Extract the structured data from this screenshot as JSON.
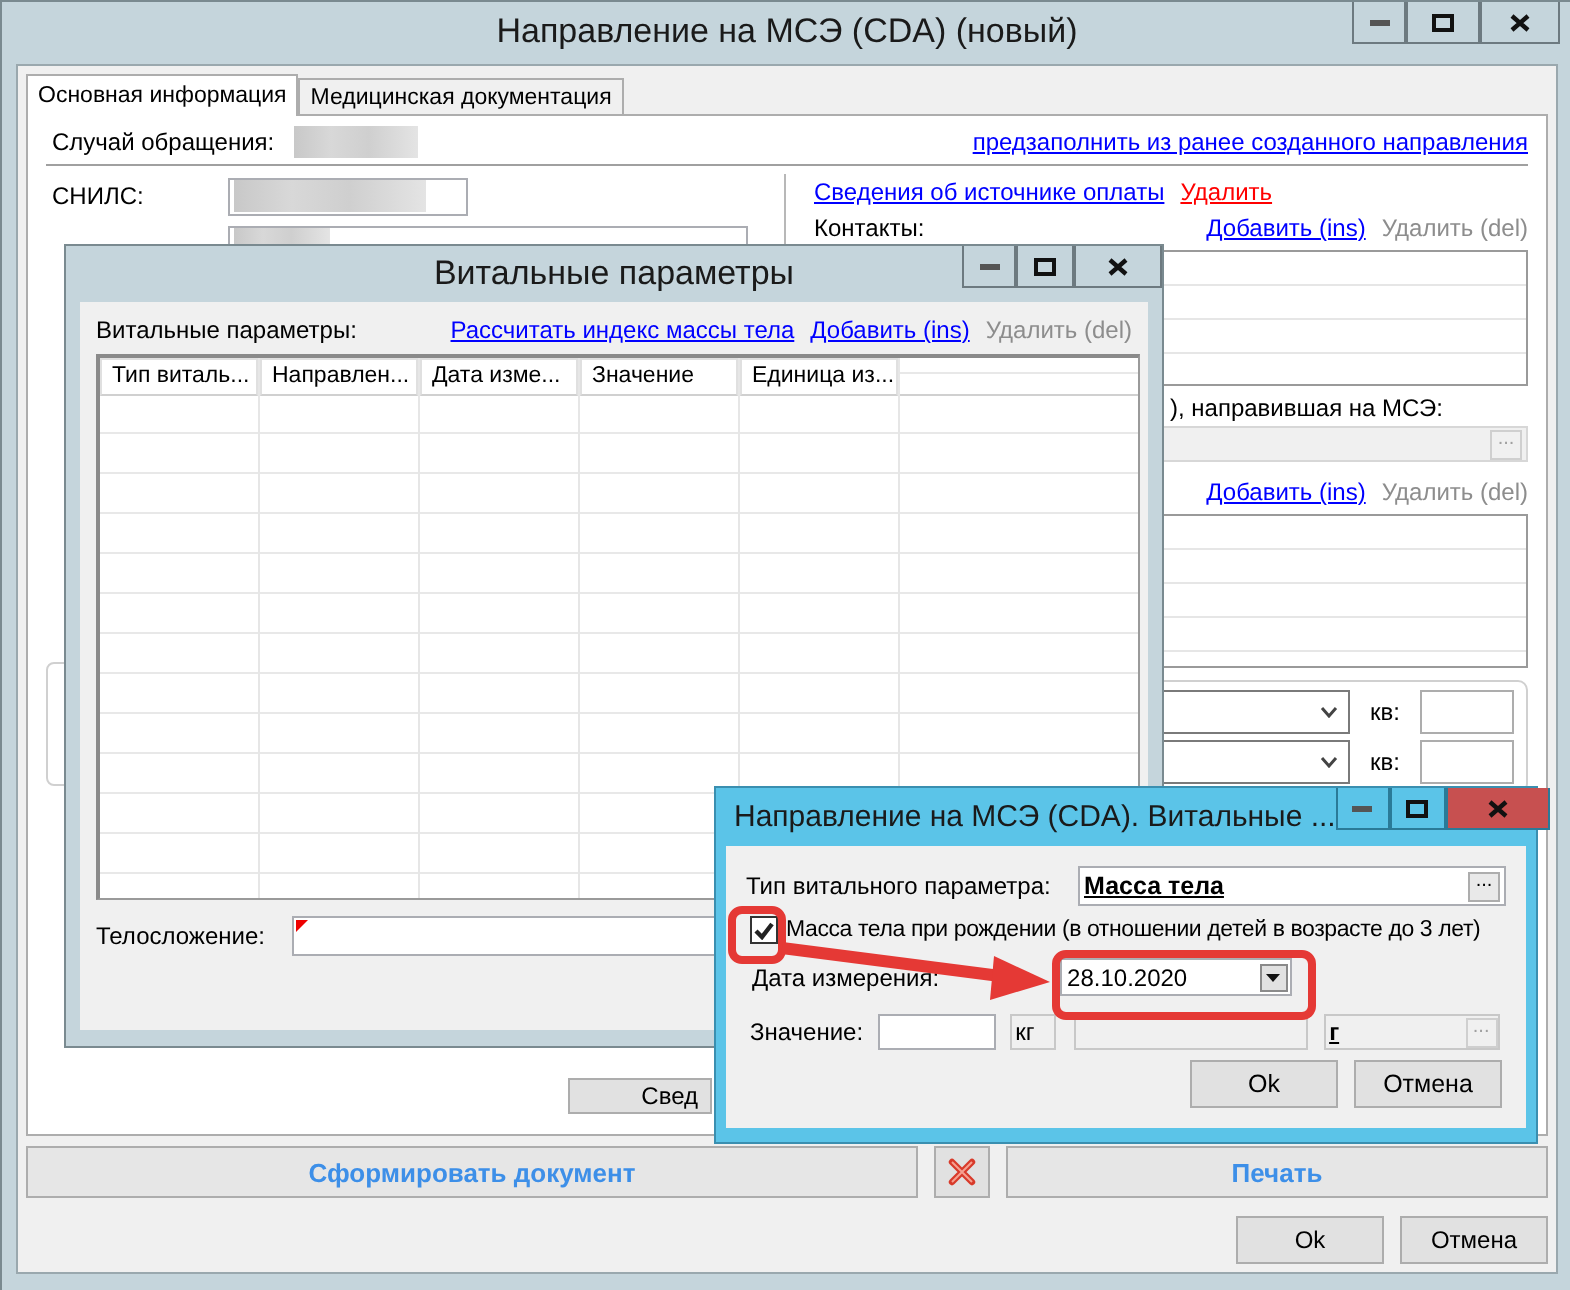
{
  "main_window": {
    "title": "Направление на МСЭ (CDA) (новый)",
    "tabs": [
      {
        "label": "Основная информация",
        "selected": true
      },
      {
        "label": "Медицинская документация",
        "selected": false
      }
    ],
    "case_label": "Случай обращения:",
    "prefill_link": "предзаполнить из ранее созданного направления",
    "snils_label": "СНИЛС:",
    "partial_button": "Свед",
    "payment": {
      "link": "Сведения об источнике оплаты",
      "delete": "Удалить"
    },
    "contacts": {
      "label": "Контакты:",
      "actions": [
        {
          "label": "Добавить (ins)",
          "disabled": false
        },
        {
          "label": "Удалить (del)",
          "disabled": true
        }
      ]
    },
    "organization": {
      "label": "), направившая на МСЭ:",
      "browse": "..."
    },
    "org_actions": [
      {
        "label": "Добавить (ins)",
        "disabled": false
      },
      {
        "label": "Удалить (del)",
        "disabled": true
      }
    ],
    "address_rows": [
      {
        "label": "кв:"
      },
      {
        "label": "кв:"
      }
    ],
    "generate_button": "Сформировать документ",
    "print_button": "Печать",
    "ok_button": "Ok",
    "cancel_button": "Отмена"
  },
  "vital_window": {
    "title": "Витальные параметры",
    "list_label": "Витальные параметры:",
    "bmi_link": "Рассчитать индекс массы тела",
    "actions": [
      {
        "label": "Добавить (ins)",
        "disabled": false
      },
      {
        "label": "Удалить (del)",
        "disabled": true
      }
    ],
    "columns": [
      "Тип виталь...",
      "Направлен...",
      "Дата изме...",
      "Значение",
      "Единица из..."
    ],
    "build_label": "Телосложение:"
  },
  "dialog": {
    "title": "Направление на МСЭ (CDA). Витальные ...",
    "type_label": "Тип витального параметра:",
    "type_value": "Масса тела",
    "type_browse": "...",
    "birth_checkbox": {
      "label": "Масса тела при рождении (в отношении детей в возрасте до 3 лет)",
      "checked": true
    },
    "date_label": "Дата измерения:",
    "date_value": "28.10.2020",
    "value_label": "Значение:",
    "unit": "кг",
    "small_unit": "г",
    "small_unit_browse": "...",
    "ok_button": "Ok",
    "cancel_button": "Отмена"
  }
}
